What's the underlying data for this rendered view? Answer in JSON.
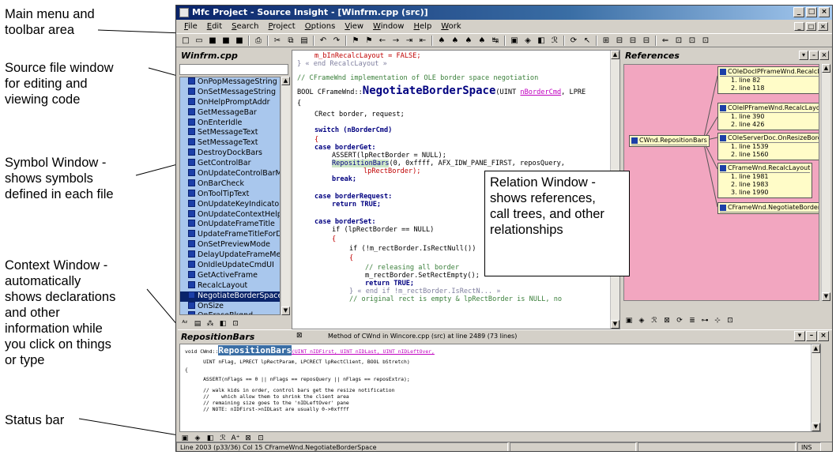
{
  "callouts": {
    "main_menu": "Main menu and\ntoolbar area",
    "source_window": "Source file window\nfor editing and\nviewing code",
    "symbol_window": "Symbol Window -\nshows symbols\ndefined in each  file",
    "context_window": "Context  Window -\nautomatically\nshows declarations\nand other\ninformation while\nyou click on things\nor type",
    "status_bar": "Status bar",
    "relation_window": "Relation Window -\nshows references,\ncall trees, and other\nrelationships"
  },
  "window": {
    "title": "Mfc Project - Source Insight - [Winfrm.cpp (src)]",
    "controls": [
      "_",
      "□",
      "×"
    ]
  },
  "menu": [
    "File",
    "Edit",
    "Search",
    "Project",
    "Options",
    "View",
    "Window",
    "Help",
    "Work"
  ],
  "symbol_pane": {
    "title": "Winfrm.cpp",
    "items": [
      "OnPopMessageString",
      "OnSetMessageString",
      "OnHelpPromptAddr",
      "GetMessageBar",
      "OnEnterIdle",
      "SetMessageText",
      "SetMessageText",
      "DestroyDockBars",
      "GetControlBar",
      "OnUpdateControlBarM",
      "OnBarCheck",
      "OnToolTipText",
      "OnUpdateKeyIndicato",
      "OnUpdateContextHelp",
      "OnUpdateFrameTitle",
      "UpdateFrameTitleForD",
      "OnSetPreviewMode",
      "DelayUpdateFrameMe",
      "OnIdleUpdateCmdUI",
      "GetActiveFrame",
      "RecalcLayout",
      "NegotiateBorderSpace",
      "OnSize",
      "OnEraseBkgnd"
    ],
    "selected_index": 21
  },
  "source_pane": {
    "lines": [
      "m_bInRecalcLayout = FALSE;",
      "} « end RecalcLayout »",
      "// CFrameWnd implementation of OLE border space negotiation",
      "BOOL CFrameWnd::",
      "NegotiateBorderSpace",
      "(UINT ",
      "nBorderCmd",
      ", LPRE",
      "{",
      "CRect border, request;",
      "switch (nBorderCmd)",
      "{",
      "case borderGet:",
      "ASSERT(lpRectBorder = NULL);",
      "RepositionBars",
      "(0, 0xffff, AFX_IDW_PANE_FIRST, reposQuery,",
      "lpRectBorder);",
      "break;",
      "case borderRequest:",
      "return TRUE;",
      "case borderSet:",
      "if (lpRectBorder == NULL)",
      "{",
      "if (!m_rectBorder.IsRectNull())",
      "{",
      "// releasing all border",
      "m_rectBorder.SetRectEmpty();",
      "return TRUE;",
      "} « end if !m_rectBorder.IsRectN... »",
      "// original rect is empty & lpRectBorder is NULL, no"
    ]
  },
  "ref_pane": {
    "title": "References",
    "root": "CWnd.RepositionBars",
    "nodes": [
      {
        "title": "COleDocIPFrameWnd.RecalcLayout",
        "lines": [
          "1. line 82",
          "2. line 118"
        ]
      },
      {
        "title": "COleIPFrameWnd.RecalcLayout",
        "lines": [
          "1. line 390",
          "2. line 426"
        ]
      },
      {
        "title": "COleServerDoc.OnResizeBorder",
        "lines": [
          "1. line 1539",
          "2. line 1560"
        ]
      },
      {
        "title": "CFrameWnd.RecalcLayout",
        "lines": [
          "1. line 1981",
          "2. line 1983",
          "3. line 1990"
        ]
      },
      {
        "title": "CFrameWnd.NegotiateBorderSpace",
        "lines": []
      }
    ]
  },
  "context_pane": {
    "title": "RepositionBars",
    "info": "Method of CWnd in Wincore.cpp (src) at line 2489 (73 lines)",
    "lines": [
      "void CWnd::",
      "RepositionBars",
      "(UINT nIDFirst, UINT nIDLast, UINT nIDLeftOver,",
      "      UINT nFlag, LPRECT lpRectParam, LPCRECT lpRectClient, BOOL bStretch)",
      "{",
      "      ASSERT(nFlags == 0 || nFlags == reposQuery || nFlags == reposExtra);",
      "      // walk kids in order, control bars get the resize notification",
      "      //    which allow them to shrink the client area",
      "      // remaining size goes to the 'nIDLeftOver' pane",
      "      // NOTE: nIDFirst->nIDLast are usually 0->0xffff"
    ]
  },
  "status": {
    "position": "Line 2003 (p33/36) Col 15  CFrameWnd.NegotiateBorderSpace",
    "mode": "INS"
  },
  "colors": {
    "symbol_list_bg": "#a9c7ed",
    "relation_bg": "#f2a6c0",
    "titlebar": "#0a246a"
  }
}
